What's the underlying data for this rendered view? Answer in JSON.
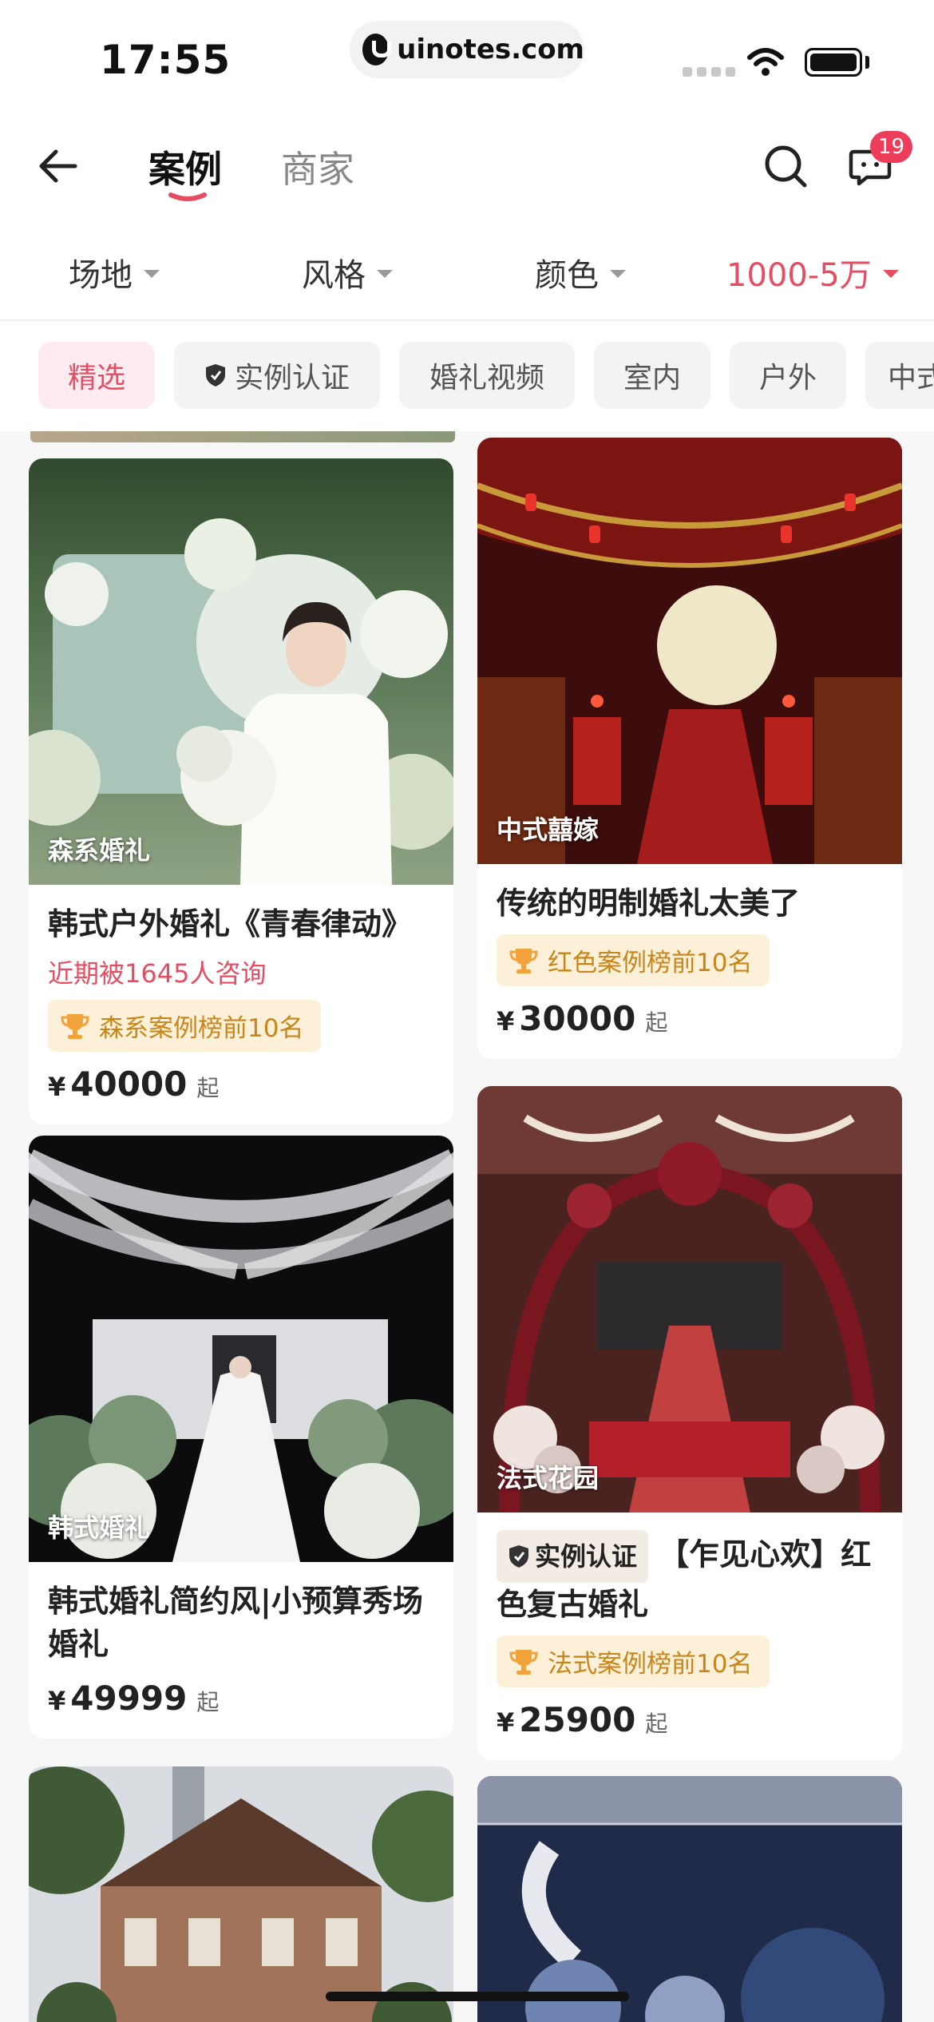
{
  "status_bar": {
    "time": "17:55",
    "url": "uinotes.com"
  },
  "nav": {
    "tabs": [
      {
        "label": "案例"
      },
      {
        "label": "商家"
      }
    ],
    "message_badge": "19"
  },
  "filters": [
    {
      "label": "场地"
    },
    {
      "label": "风格"
    },
    {
      "label": "颜色"
    },
    {
      "label": "1000-5万"
    }
  ],
  "chips": [
    {
      "label": "精选"
    },
    {
      "label": "实例认证"
    },
    {
      "label": "婚礼视频"
    },
    {
      "label": "室内"
    },
    {
      "label": "户外"
    },
    {
      "label": "中式"
    }
  ],
  "cards": [
    {
      "tag": "森系婚礼",
      "title": "韩式户外婚礼《青春律动》",
      "consult": "近期被1645人咨询",
      "rank": "森系案例榜前10名",
      "currency": "¥",
      "price": "40000",
      "suffix": "起"
    },
    {
      "tag": "中式囍嫁",
      "title": "传统的明制婚礼太美了",
      "rank": "红色案例榜前10名",
      "currency": "¥",
      "price": "30000",
      "suffix": "起"
    },
    {
      "tag": "韩式婚礼",
      "title": "韩式婚礼简约风|小预算秀场婚礼",
      "currency": "¥",
      "price": "49999",
      "suffix": "起"
    },
    {
      "tag": "法式花园",
      "verify": "实例认证",
      "title": "【乍见心欢】红色复古婚礼",
      "rank": "法式案例榜前10名",
      "currency": "¥",
      "price": "25900",
      "suffix": "起"
    }
  ],
  "colors": {
    "accent": "#e64d63",
    "rank_bg": "#fdf0d8",
    "rank_text": "#c8861a"
  },
  "icons": [
    "back-arrow-icon",
    "search-icon",
    "message-icon",
    "shield-icon",
    "trophy-icon",
    "wifi-icon",
    "battery-icon"
  ]
}
